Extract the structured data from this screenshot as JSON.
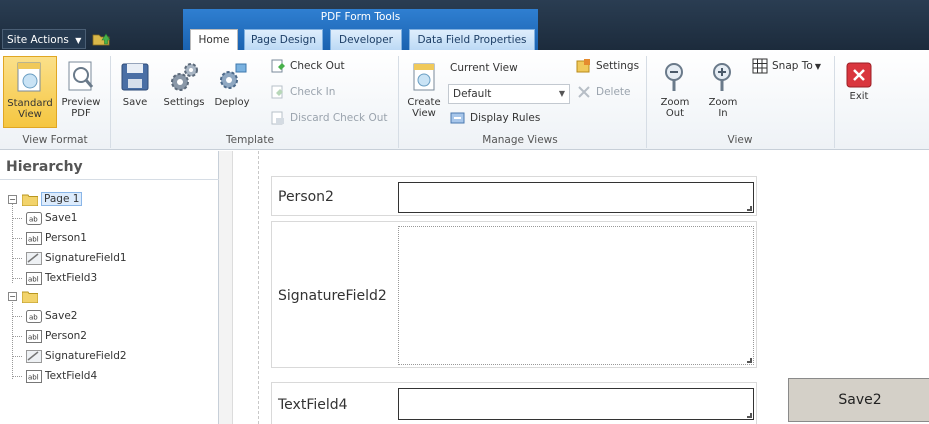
{
  "topbar": {
    "site_actions": "Site Actions",
    "context_title": "PDF Form Tools",
    "tabs": [
      "Home",
      "Page Design",
      "Developer",
      "Data Field Properties"
    ]
  },
  "ribbon": {
    "view_format": {
      "label": "View Format",
      "standard_view": "Standard View",
      "preview_pdf": "Preview PDF"
    },
    "template": {
      "label": "Template",
      "save": "Save",
      "settings": "Settings",
      "deploy": "Deploy",
      "check_out": "Check Out",
      "check_in": "Check In",
      "discard_check_out": "Discard Check Out"
    },
    "manage_views": {
      "label": "Manage Views",
      "create_view": "Create View",
      "current_view": "Current View",
      "current_view_value": "Default",
      "display_rules": "Display Rules",
      "settings": "Settings",
      "delete": "Delete"
    },
    "view": {
      "label": "View",
      "zoom_out": "Zoom Out",
      "zoom_in": "Zoom In",
      "snap_to": "Snap To"
    },
    "exit": "Exit"
  },
  "hierarchy": {
    "title": "Hierarchy",
    "nodes": [
      {
        "label": "Page 1"
      },
      {
        "label": "Save1"
      },
      {
        "label": "Person1"
      },
      {
        "label": "SignatureField1"
      },
      {
        "label": "TextField3"
      },
      {
        "label": ""
      },
      {
        "label": "Save2"
      },
      {
        "label": "Person2"
      },
      {
        "label": "SignatureField2"
      },
      {
        "label": "TextField4"
      }
    ]
  },
  "form": {
    "person2": "Person2",
    "signature2": "SignatureField2",
    "textfield4": "TextField4",
    "save2": "Save2"
  },
  "colors": {
    "top_bar": "#1c2b3c",
    "context_band": "#1a62b0",
    "active_button": "#f5c640",
    "exit_red": "#d9363e"
  }
}
